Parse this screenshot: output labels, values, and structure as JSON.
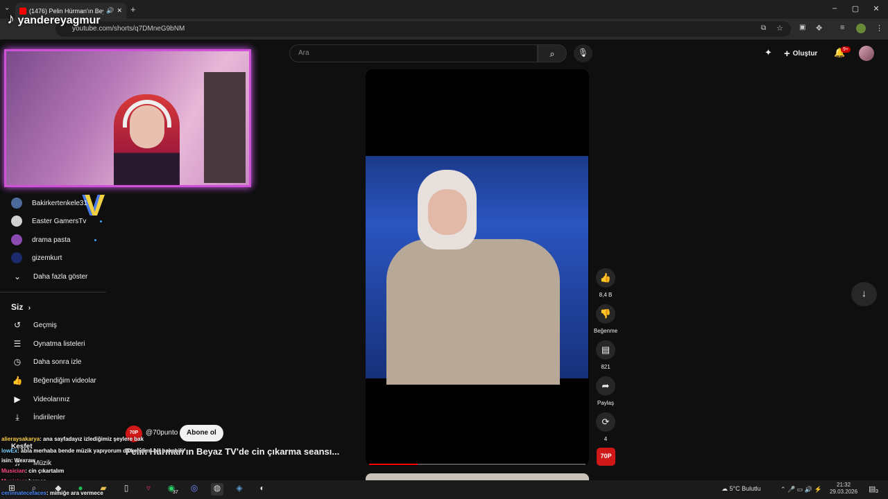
{
  "browser": {
    "tab_title": "(1476) Pelin Hürman'ın Bey",
    "url": "youtube.com/shorts/q7DMneG9bNM",
    "new_tab": "+"
  },
  "overlay": {
    "streamer": "yandereyagmur"
  },
  "youtube": {
    "search_placeholder": "Ara",
    "create_label": "Oluştur",
    "notif_badge": "9+"
  },
  "sidebar": {
    "subscriptions": [
      {
        "label": "Bakirkertenkele31",
        "color": "#4a6a9a",
        "live": false
      },
      {
        "label": "Easter GamersTv",
        "color": "#d0d0d0",
        "live": true
      },
      {
        "label": "drama pasta",
        "color": "#8a4ab0",
        "live": true
      },
      {
        "label": "gizemkurt",
        "color": "#1a2a6a",
        "live": false
      }
    ],
    "show_more": "Daha fazla göster",
    "you_header": "Siz",
    "you_items": [
      {
        "label": "Geçmiş",
        "icon": "history-icon"
      },
      {
        "label": "Oynatma listeleri",
        "icon": "playlist-icon"
      },
      {
        "label": "Daha sonra izle",
        "icon": "watch-later-icon"
      },
      {
        "label": "Beğendiğim videolar",
        "icon": "like-icon"
      },
      {
        "label": "Videolarınız",
        "icon": "video-icon"
      },
      {
        "label": "İndirilenler",
        "icon": "download-icon"
      }
    ],
    "explore": "Keşfet",
    "music": "Müzik"
  },
  "short": {
    "channel": "@70punto",
    "channel_logo": "70P",
    "subscribe": "Abone ol",
    "title": "Pelin Hürman'ın Beyaz TV'de cin çıkarma seansı...",
    "likes": "8,4 B",
    "dislike": "Beğenme",
    "comments": "821",
    "share": "Paylaş",
    "remix": "4"
  },
  "chat": [
    {
      "user": "alieraysakarya",
      "msg": ": ana sayfadayız izlediğimiz şeylere bak",
      "color": "#ffd24a"
    },
    {
      "user": "lowEx",
      "msg": ": abla merhaba bende müzik yapıyorum da kendimi bir bakabilir",
      "color": "#7ad0ff"
    },
    {
      "user": "isin: Wexraw",
      "msg": "",
      "color": "#ffffff"
    },
    {
      "user": "Musician",
      "msg": ": cin çıkartalım",
      "color": "#ff4a8a"
    },
    {
      "user": "Musician",
      "msg": ": hemen",
      "color": "#ff4a8a"
    },
    {
      "user": "cerinnatecefaces",
      "msg": ": mimiğe ara vermece",
      "color": "#4a8aff"
    }
  ],
  "taskbar": {
    "whatsapp_badge": "37",
    "weather": "5°C  Bulutlu",
    "time": "21:32",
    "date": "29.03.2026",
    "notif": "3"
  }
}
